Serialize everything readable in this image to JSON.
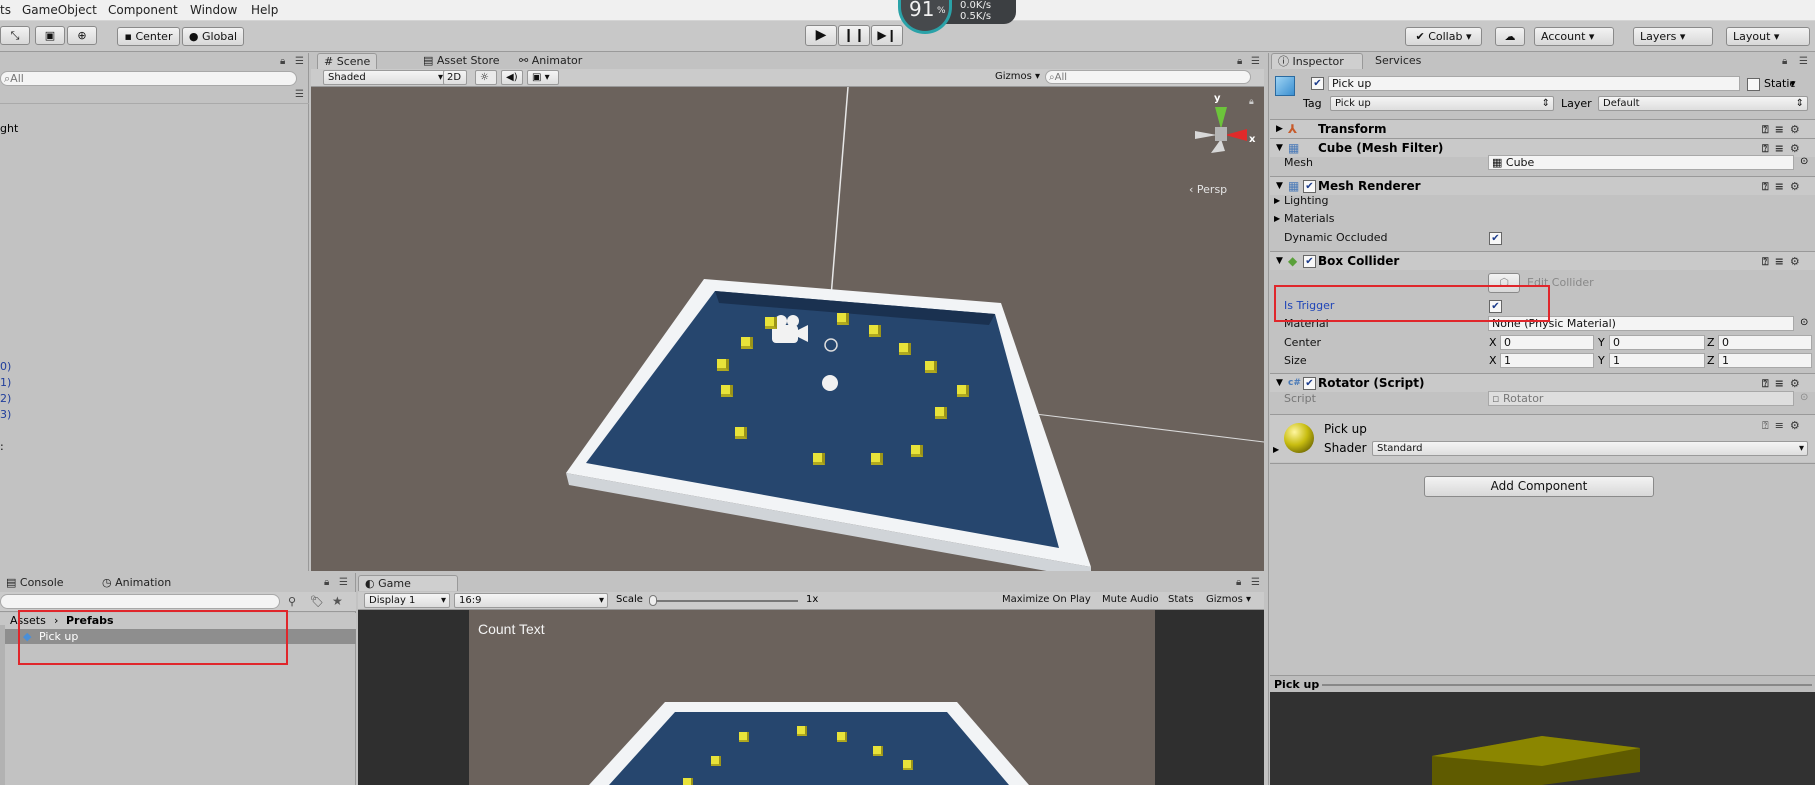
{
  "menu": [
    "ts",
    "GameObject",
    "Component",
    "Window",
    "Help"
  ],
  "toolbar": {
    "pivot": "Center",
    "space": "Global",
    "collab": "Collab",
    "account": "Account",
    "layers": "Layers",
    "layout": "Layout"
  },
  "overlay": {
    "percent": "91",
    "percent_unit": "%",
    "speed_top": "0.0K/s",
    "speed_bottom": "0.5K/s"
  },
  "hierarchy": {
    "search": "All",
    "items": [
      "ght"
    ],
    "partial": [
      "0)",
      "1)",
      "2)",
      "3)",
      ":"
    ]
  },
  "scene": {
    "tabs": [
      "Scene",
      "Asset Store",
      "Animator"
    ],
    "shading": "Shaded",
    "mode2d": "2D",
    "gizmos": "Gizmos",
    "search": "All",
    "persp": "Persp",
    "axis_y": "y",
    "axis_x": "x"
  },
  "project": {
    "tabs": [
      "Console",
      "Animation"
    ],
    "breadcrumb_root": "Assets",
    "breadcrumb_sep": "›",
    "breadcrumb_folder": "Prefabs",
    "item": "Pick up"
  },
  "game": {
    "tab": "Game",
    "display": "Display 1",
    "aspect": "16:9",
    "scale_label": "Scale",
    "scale_value": "1x",
    "buttons": [
      "Maximize On Play",
      "Mute Audio",
      "Stats",
      "Gizmos"
    ],
    "count_text": "Count Text"
  },
  "inspector": {
    "tabs": [
      "Inspector",
      "Services"
    ],
    "name": "Pick up",
    "static_label": "Static",
    "tag_label": "Tag",
    "tag_value": "Pick up",
    "layer_label": "Layer",
    "layer_value": "Default",
    "transform": "Transform",
    "mesh_filter": "Cube (Mesh Filter)",
    "mesh_label": "Mesh",
    "mesh_value": "Cube",
    "mesh_renderer": "Mesh Renderer",
    "lighting": "Lighting",
    "materials": "Materials",
    "dynamic_occluded": "Dynamic Occluded",
    "box_collider": "Box Collider",
    "edit_collider": "Edit Collider",
    "is_trigger": "Is Trigger",
    "material_label": "Material",
    "material_value": "None (Physic Material)",
    "center_label": "Center",
    "center": {
      "x": "0",
      "y": "0",
      "z": "0"
    },
    "size_label": "Size",
    "size": {
      "x": "1",
      "y": "1",
      "z": "1"
    },
    "rotator": "Rotator (Script)",
    "script_label": "Script",
    "script_value": "Rotator",
    "material_name": "Pick up",
    "shader_label": "Shader",
    "shader_value": "Standard",
    "add_component": "Add Component",
    "preview_title": "Pick up",
    "axis_labels": {
      "x": "X",
      "y": "Y",
      "z": "Z"
    }
  },
  "colors": {
    "highlight": "#e0262b",
    "floor": "#26466e",
    "pickup": "#e8e33a",
    "scene_bg": "#6b625c"
  }
}
